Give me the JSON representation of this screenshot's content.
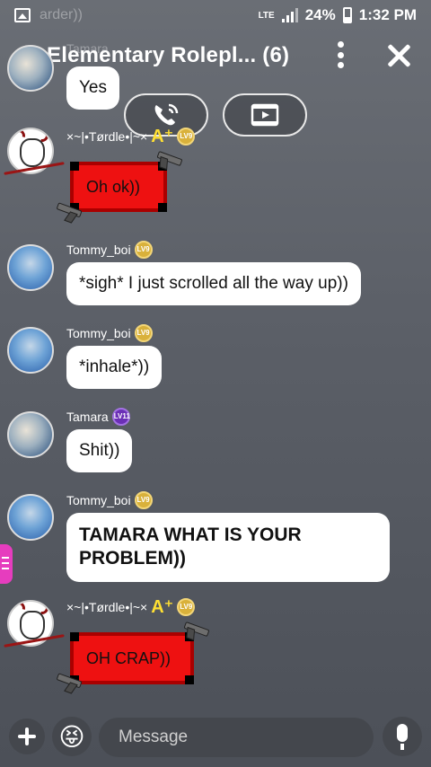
{
  "status_bar": {
    "ghost_text": "arder))",
    "network": "LTE",
    "battery": "24%",
    "time": "1:32 PM"
  },
  "header": {
    "title": "Elementary Rolepl... (6)",
    "ghost_name": "Tamara"
  },
  "icons": {
    "voice_call": "phone-call-icon",
    "video_call": "video-play-icon",
    "more": "more-vertical-icon",
    "close": "close-icon",
    "add": "plus-icon",
    "emoji": "emoji-icon",
    "mic": "microphone-icon"
  },
  "messages": [
    {
      "user": "Tamara",
      "level": "LV11",
      "text": "Yes",
      "style": "bubble"
    },
    {
      "user": "×~|•Tørdle•|~×",
      "level": "LV9",
      "text": "Oh ok))",
      "style": "red-frame"
    },
    {
      "user": "Tommy_boi",
      "level": "LV9",
      "text": "*sigh* I just scrolled all the way up))",
      "style": "bubble"
    },
    {
      "user": "Tommy_boi",
      "level": "LV9",
      "text": "*inhale*))",
      "style": "bubble"
    },
    {
      "user": "Tamara",
      "level": "LV11",
      "text": "Shit))",
      "style": "bubble"
    },
    {
      "user": "Tommy_boi",
      "level": "LV9",
      "text": " TAMARA WHAT IS YOUR PROBLEM))",
      "style": "bubble-bold"
    },
    {
      "user": "×~|•Tørdle•|~×",
      "level": "LV9",
      "text": "OH CRAP))",
      "style": "red-frame"
    }
  ],
  "composer": {
    "placeholder": "Message",
    "value": ""
  },
  "colors": {
    "accent_gold": "#d9b13b",
    "accent_purple": "#6b2fb6",
    "frame_red": "#e11111",
    "side_tab": "#e63dbe"
  }
}
